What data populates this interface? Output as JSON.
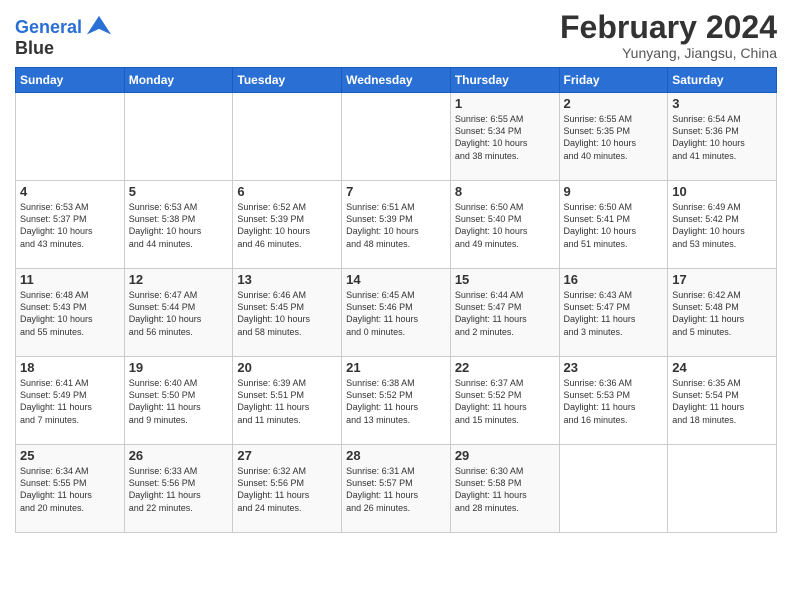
{
  "logo": {
    "line1": "General",
    "line2": "Blue"
  },
  "title": "February 2024",
  "subtitle": "Yunyang, Jiangsu, China",
  "days_header": [
    "Sunday",
    "Monday",
    "Tuesday",
    "Wednesday",
    "Thursday",
    "Friday",
    "Saturday"
  ],
  "weeks": [
    [
      {
        "day": "",
        "info": ""
      },
      {
        "day": "",
        "info": ""
      },
      {
        "day": "",
        "info": ""
      },
      {
        "day": "",
        "info": ""
      },
      {
        "day": "1",
        "info": "Sunrise: 6:55 AM\nSunset: 5:34 PM\nDaylight: 10 hours\nand 38 minutes."
      },
      {
        "day": "2",
        "info": "Sunrise: 6:55 AM\nSunset: 5:35 PM\nDaylight: 10 hours\nand 40 minutes."
      },
      {
        "day": "3",
        "info": "Sunrise: 6:54 AM\nSunset: 5:36 PM\nDaylight: 10 hours\nand 41 minutes."
      }
    ],
    [
      {
        "day": "4",
        "info": "Sunrise: 6:53 AM\nSunset: 5:37 PM\nDaylight: 10 hours\nand 43 minutes."
      },
      {
        "day": "5",
        "info": "Sunrise: 6:53 AM\nSunset: 5:38 PM\nDaylight: 10 hours\nand 44 minutes."
      },
      {
        "day": "6",
        "info": "Sunrise: 6:52 AM\nSunset: 5:39 PM\nDaylight: 10 hours\nand 46 minutes."
      },
      {
        "day": "7",
        "info": "Sunrise: 6:51 AM\nSunset: 5:39 PM\nDaylight: 10 hours\nand 48 minutes."
      },
      {
        "day": "8",
        "info": "Sunrise: 6:50 AM\nSunset: 5:40 PM\nDaylight: 10 hours\nand 49 minutes."
      },
      {
        "day": "9",
        "info": "Sunrise: 6:50 AM\nSunset: 5:41 PM\nDaylight: 10 hours\nand 51 minutes."
      },
      {
        "day": "10",
        "info": "Sunrise: 6:49 AM\nSunset: 5:42 PM\nDaylight: 10 hours\nand 53 minutes."
      }
    ],
    [
      {
        "day": "11",
        "info": "Sunrise: 6:48 AM\nSunset: 5:43 PM\nDaylight: 10 hours\nand 55 minutes."
      },
      {
        "day": "12",
        "info": "Sunrise: 6:47 AM\nSunset: 5:44 PM\nDaylight: 10 hours\nand 56 minutes."
      },
      {
        "day": "13",
        "info": "Sunrise: 6:46 AM\nSunset: 5:45 PM\nDaylight: 10 hours\nand 58 minutes."
      },
      {
        "day": "14",
        "info": "Sunrise: 6:45 AM\nSunset: 5:46 PM\nDaylight: 11 hours\nand 0 minutes."
      },
      {
        "day": "15",
        "info": "Sunrise: 6:44 AM\nSunset: 5:47 PM\nDaylight: 11 hours\nand 2 minutes."
      },
      {
        "day": "16",
        "info": "Sunrise: 6:43 AM\nSunset: 5:47 PM\nDaylight: 11 hours\nand 3 minutes."
      },
      {
        "day": "17",
        "info": "Sunrise: 6:42 AM\nSunset: 5:48 PM\nDaylight: 11 hours\nand 5 minutes."
      }
    ],
    [
      {
        "day": "18",
        "info": "Sunrise: 6:41 AM\nSunset: 5:49 PM\nDaylight: 11 hours\nand 7 minutes."
      },
      {
        "day": "19",
        "info": "Sunrise: 6:40 AM\nSunset: 5:50 PM\nDaylight: 11 hours\nand 9 minutes."
      },
      {
        "day": "20",
        "info": "Sunrise: 6:39 AM\nSunset: 5:51 PM\nDaylight: 11 hours\nand 11 minutes."
      },
      {
        "day": "21",
        "info": "Sunrise: 6:38 AM\nSunset: 5:52 PM\nDaylight: 11 hours\nand 13 minutes."
      },
      {
        "day": "22",
        "info": "Sunrise: 6:37 AM\nSunset: 5:52 PM\nDaylight: 11 hours\nand 15 minutes."
      },
      {
        "day": "23",
        "info": "Sunrise: 6:36 AM\nSunset: 5:53 PM\nDaylight: 11 hours\nand 16 minutes."
      },
      {
        "day": "24",
        "info": "Sunrise: 6:35 AM\nSunset: 5:54 PM\nDaylight: 11 hours\nand 18 minutes."
      }
    ],
    [
      {
        "day": "25",
        "info": "Sunrise: 6:34 AM\nSunset: 5:55 PM\nDaylight: 11 hours\nand 20 minutes."
      },
      {
        "day": "26",
        "info": "Sunrise: 6:33 AM\nSunset: 5:56 PM\nDaylight: 11 hours\nand 22 minutes."
      },
      {
        "day": "27",
        "info": "Sunrise: 6:32 AM\nSunset: 5:56 PM\nDaylight: 11 hours\nand 24 minutes."
      },
      {
        "day": "28",
        "info": "Sunrise: 6:31 AM\nSunset: 5:57 PM\nDaylight: 11 hours\nand 26 minutes."
      },
      {
        "day": "29",
        "info": "Sunrise: 6:30 AM\nSunset: 5:58 PM\nDaylight: 11 hours\nand 28 minutes."
      },
      {
        "day": "",
        "info": ""
      },
      {
        "day": "",
        "info": ""
      }
    ]
  ]
}
